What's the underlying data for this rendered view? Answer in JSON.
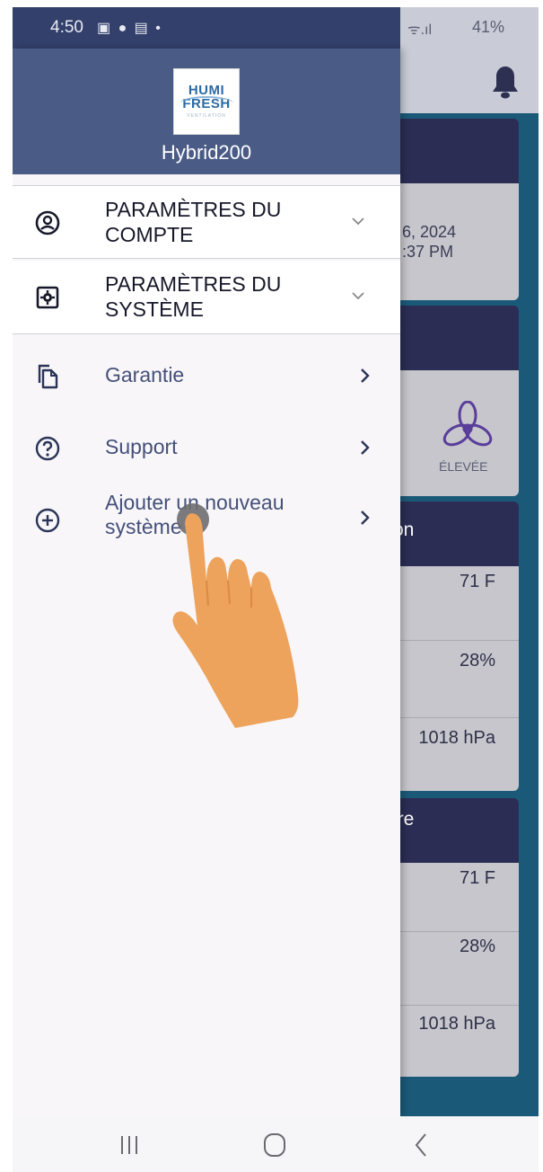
{
  "status_bar": {
    "time": "4:50",
    "notification_icons": "▣ ● ▤ •",
    "wifi_signal": "ᯤ.ıl",
    "battery": "41%"
  },
  "drawer": {
    "device_name": "Hybrid200",
    "logo": {
      "line1": "HUMI",
      "line2": "FRESH",
      "tagline": "VENTILATION"
    },
    "sections": [
      {
        "title": "PARAMÈTRES DU COMPTE",
        "icon": "account-circle-icon"
      },
      {
        "title": "PARAMÈTRES DU SYSTÈME",
        "icon": "system-settings-icon"
      }
    ],
    "items": [
      {
        "label": "Garantie",
        "icon": "copy-document-icon"
      },
      {
        "label": "Support",
        "icon": "help-circle-icon"
      },
      {
        "label": "Ajouter un nouveau système",
        "icon": "add-circle-icon"
      }
    ]
  },
  "background_app": {
    "date_line1": "6, 2024",
    "date_line2": ":37 PM",
    "fan_speed_label": "ÉLEVÉE",
    "section_a_title": "on",
    "section_a_values": [
      "71 F",
      "28%",
      "1018 hPa"
    ],
    "section_b_title": "ire",
    "section_b_values": [
      "71 F",
      "28%",
      "1018 hPa"
    ]
  },
  "colors": {
    "drawer_header": "#4a5b86",
    "status_bar_dark": "#33406c",
    "card_header": "#2b2d54",
    "app_background": "#1a5a78",
    "nav_text": "#44507a",
    "hand": "#eda35c"
  }
}
